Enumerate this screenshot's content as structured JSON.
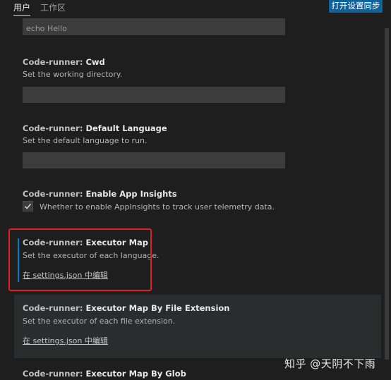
{
  "header": {
    "tabs": [
      {
        "label": "用户",
        "active": true
      },
      {
        "label": "工作区",
        "active": false
      }
    ],
    "sync_button_label": "打开设置同步"
  },
  "top_field": {
    "value": "echo Hello"
  },
  "settings": [
    {
      "category": "Code-runner: ",
      "name": "Cwd",
      "description": "Set the working directory.",
      "field_value": ""
    },
    {
      "category": "Code-runner: ",
      "name": "Default Language",
      "description": "Set the default language to run.",
      "field_value": ""
    },
    {
      "category": "Code-runner: ",
      "name": "Enable App Insights",
      "checkbox_label": "Whether to enable AppInsights to track user telemetry data.",
      "checked": true
    },
    {
      "category": "Code-runner: ",
      "name": "Executor Map",
      "description": "Set the executor of each language.",
      "link": "在 settings.json 中编辑"
    },
    {
      "category": "Code-runner: ",
      "name": "Executor Map By File Extension",
      "description": "Set the executor of each file extension.",
      "link": "在 settings.json 中编辑"
    },
    {
      "category": "Code-runner: ",
      "name": "Executor Map By Glob"
    }
  ],
  "watermark": "知乎 @天阴不下雨",
  "colors": {
    "background": "#1e1e1e",
    "input": "#3c3c3c",
    "accent": "#0e639c",
    "focus": "#007acc",
    "annotation": "#e02020",
    "hover": "#2a2d2e"
  },
  "icons": {
    "checkbox": "check-icon"
  }
}
